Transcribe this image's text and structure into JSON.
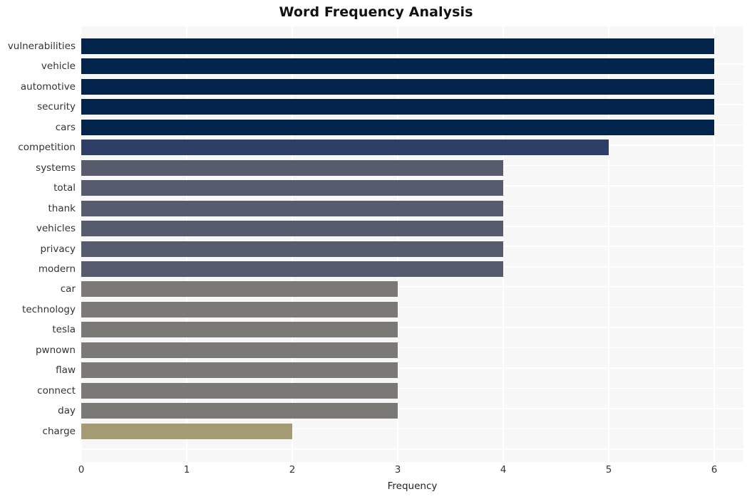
{
  "chart_data": {
    "type": "bar",
    "orientation": "horizontal",
    "title": "Word Frequency Analysis",
    "xlabel": "Frequency",
    "ylabel": "",
    "xlim": [
      0,
      6
    ],
    "xticks": [
      0,
      1,
      2,
      3,
      4,
      5,
      6
    ],
    "xtick_labels": [
      "0",
      "1",
      "2",
      "3",
      "4",
      "5",
      "6"
    ],
    "grid": true,
    "grid_color": "#ffffff",
    "plot_background": "#f7f7f7",
    "legend": null,
    "categories": [
      "vulnerabilities",
      "vehicle",
      "automotive",
      "security",
      "cars",
      "competition",
      "systems",
      "total",
      "thank",
      "vehicles",
      "privacy",
      "modern",
      "car",
      "technology",
      "tesla",
      "pwnown",
      "flaw",
      "connect",
      "day",
      "charge"
    ],
    "values": [
      6,
      6,
      6,
      6,
      6,
      5,
      4,
      4,
      4,
      4,
      4,
      4,
      3,
      3,
      3,
      3,
      3,
      3,
      3,
      2
    ],
    "colors": [
      "#02244a",
      "#02244a",
      "#02244a",
      "#02244a",
      "#02244a",
      "#2e3e67",
      "#565c6e",
      "#565c6e",
      "#565c6e",
      "#565c6e",
      "#565c6e",
      "#565c6e",
      "#7a7976",
      "#7a7976",
      "#7a7976",
      "#7a7976",
      "#7a7976",
      "#7a7976",
      "#7a7976",
      "#a59b72"
    ]
  }
}
